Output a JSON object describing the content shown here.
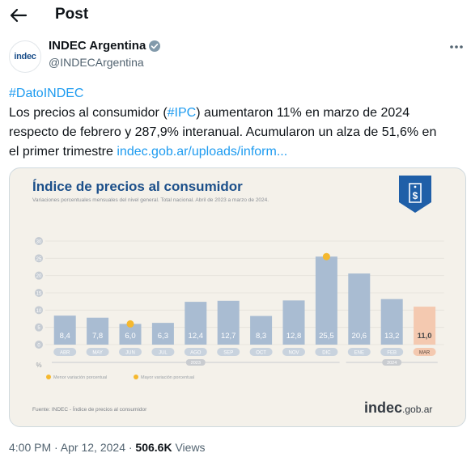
{
  "header": {
    "title": "Post"
  },
  "author": {
    "name": "INDEC Argentina",
    "handle": "@INDECArgentina",
    "avatar_text": "indec"
  },
  "tweet": {
    "hashtag": "#DatoINDEC",
    "line1_pre": "Los precios al consumidor (",
    "ipc": "#IPC",
    "line1_post": ") aumentaron 11% en marzo de 2024",
    "line2": "respecto de febrero y 287,9% interanual. Acumularon un alza de 51,6% en",
    "line3": "el primer trimestre ",
    "link": "indec.gob.ar/uploads/inform..."
  },
  "media": {
    "source": "Fuente: INDEC - Índice de precios al consumidor",
    "logo_main": "indec",
    "logo_rest": ".gob.ar",
    "legend_min": "Menor variación porcentual",
    "legend_max": "Mayor variación porcentual"
  },
  "chart_data": {
    "type": "bar",
    "title": "Índice de precios al consumidor",
    "subtitle": "Variaciones porcentuales mensuales del nivel general. Total nacional. Abril de 2023 a marzo de 2024.",
    "ylabel": "%",
    "ylim": [
      0,
      30
    ],
    "yticks": [
      "30",
      "25",
      "20",
      "15",
      "10",
      "5",
      "0"
    ],
    "categories": [
      "ABR",
      "MAY",
      "JUN",
      "JUL",
      "AGO",
      "SEP",
      "OCT",
      "NOV",
      "DIC",
      "ENE",
      "FEB",
      "MAR"
    ],
    "values": [
      8.4,
      7.8,
      6.0,
      6.3,
      12.4,
      12.7,
      8.3,
      12.8,
      25.5,
      20.6,
      13.2,
      11.0
    ],
    "value_labels": [
      "8,4",
      "7,8",
      "6,0",
      "6,3",
      "12,4",
      "12,7",
      "8,3",
      "12,8",
      "25,5",
      "20,6",
      "13,2",
      "11,0"
    ],
    "year_labels": [
      "2023",
      "2024"
    ],
    "colors": {
      "bar": "#a9bcd2",
      "highlight": "#f4c9b0",
      "marker": "#f5b82e",
      "label_bg": "#c9d3de"
    }
  },
  "footer": {
    "time": "4:00 PM · Apr 12, 2024 · ",
    "views": "506.6K",
    "views_label": " Views"
  }
}
